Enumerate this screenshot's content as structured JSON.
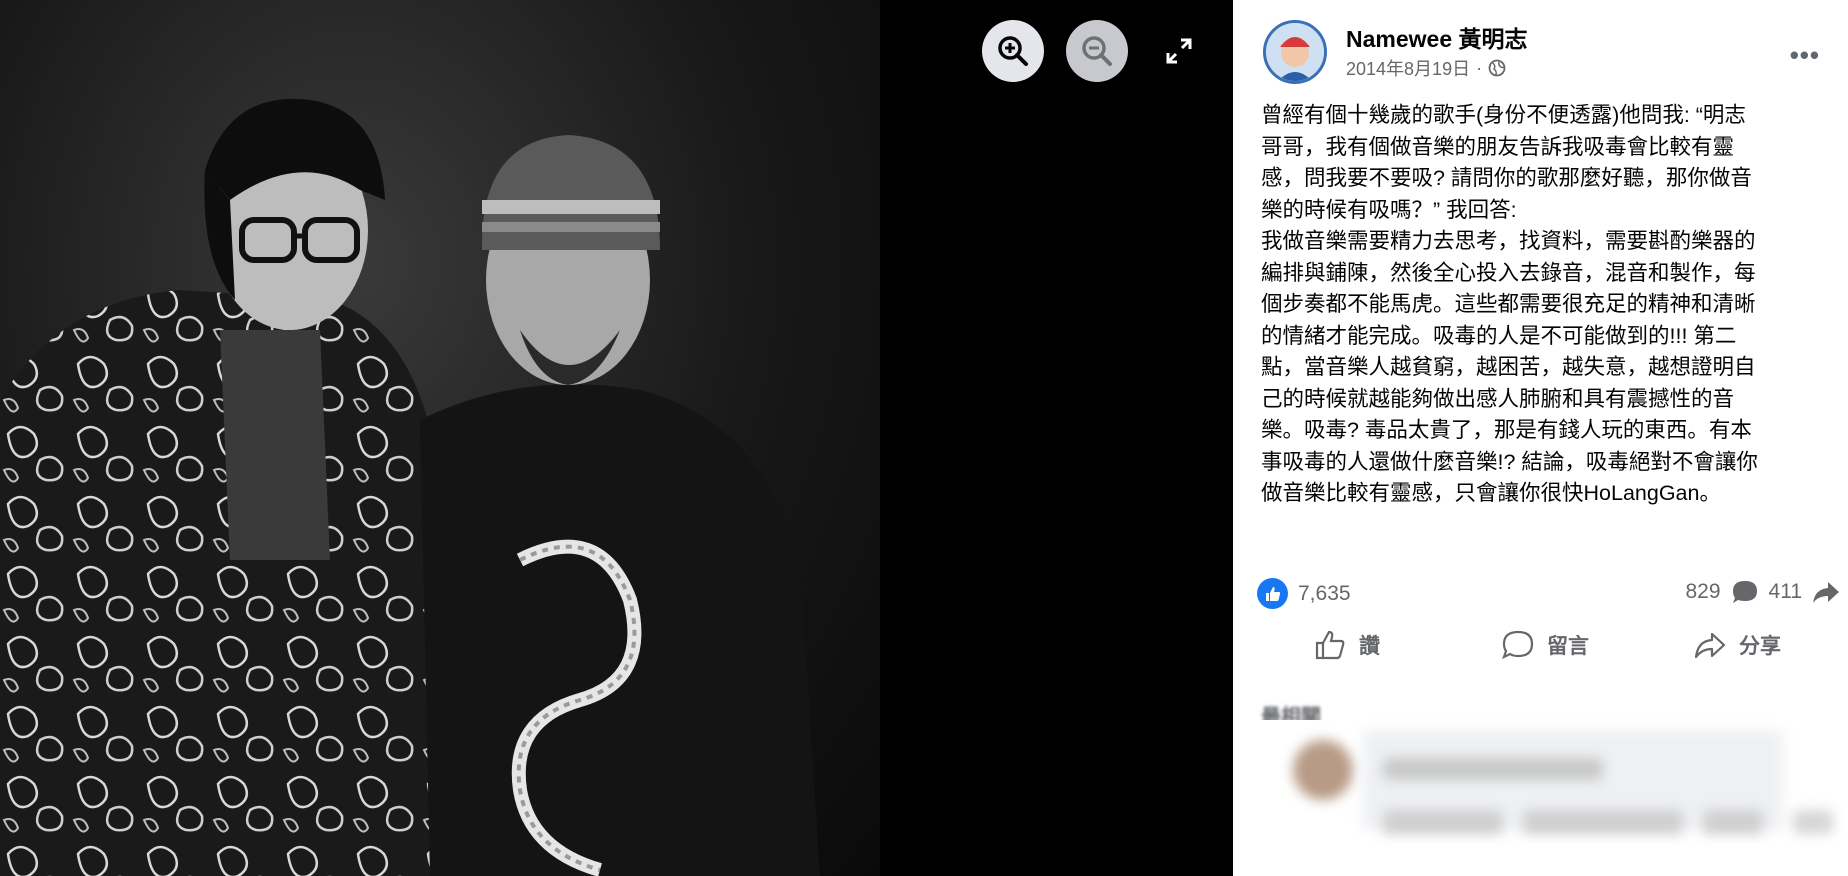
{
  "viewer": {
    "zoom_in_icon": "zoom-in-icon",
    "zoom_out_icon": "zoom-out-icon",
    "fullscreen_icon": "fullscreen-icon"
  },
  "post": {
    "author": "Namewee 黃明志",
    "date": "2014年8月19日",
    "date_separator": "·",
    "privacy_icon": "globe-icon",
    "more_label": "•••",
    "text": "曾經有個十幾歲的歌手(身份不便透露)他問我: “明志\n哥哥，我有個做音樂的朋友告訴我吸毒會比較有靈\n感，問我要不要吸? 請問你的歌那麼好聽，那你做音\n樂的時候有吸嗎？” 我回答:\n我做音樂需要精力去思考，找資料，需要斟酌樂器的\n編排與鋪陳，然後全心投入去錄音，混音和製作，每\n個步奏都不能馬虎。這些都需要很充足的精神和清晰\n的情緒才能完成。吸毒的人是不可能做到的!!! 第二\n點，當音樂人越貧窮，越困苦，越失意，越想證明自\n己的時候就越能夠做出感人肺腑和具有震撼性的音\n樂。吸毒? 毒品太貴了，那是有錢人玩的東西。有本\n事吸毒的人還做什麼音樂!? 結論，吸毒絕對不會讓你\n做音樂比較有靈感，只會讓你很快HoLangGan。",
    "reactions_count": "7,635",
    "comments_count": "829",
    "shares_count": "411"
  },
  "actions": {
    "like_label": "讚",
    "comment_label": "留言",
    "share_label": "分享"
  },
  "comments": {
    "sort_label": "最相關"
  },
  "colors": {
    "facebook_blue": "#1877f2",
    "secondary_text": "#65676b"
  }
}
